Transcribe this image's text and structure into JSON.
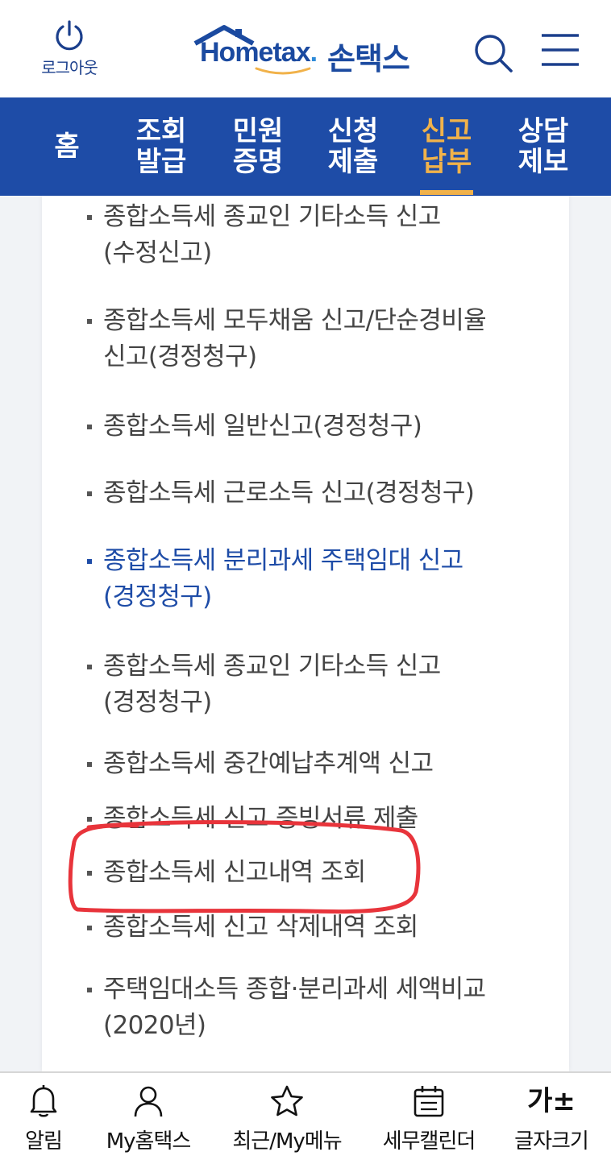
{
  "header": {
    "logout_label": "로그아웃",
    "logo_text_home": "Home",
    "logo_text_tax": "tax",
    "logo_dot": ".",
    "logo_korean": "손택스",
    "search_icon": "search-icon",
    "menu_icon": "hamburger-menu-icon",
    "brand_color": "#1e4ca7"
  },
  "gnb": {
    "items": [
      {
        "label": "홈"
      },
      {
        "label": "조회\n발급"
      },
      {
        "label": "민원\n증명"
      },
      {
        "label": "신청\n제출"
      },
      {
        "label": "신고\n납부",
        "active": true
      },
      {
        "label": "상담\n제보"
      }
    ],
    "active_color": "#f1b24a"
  },
  "menu_list": {
    "items": [
      {
        "label": "종합소득세 종교인 기타소득 신고(수정신고)"
      },
      {
        "label": "종합소득세 모두채움 신고/단순경비율 신고(경정청구)"
      },
      {
        "label": "종합소득세 일반신고(경정청구)"
      },
      {
        "label": "종합소득세 근로소득 신고(경정청구)"
      },
      {
        "label": "종합소득세 분리과세 주택임대 신고(경정청구)",
        "highlighted": true
      },
      {
        "label": "종합소득세 종교인 기타소득 신고(경정청구)"
      },
      {
        "label": "종합소득세 중간예납추계액 신고"
      },
      {
        "label": "종합소득세 신고 증빙서류 제출"
      },
      {
        "label": "종합소득세 신고내역 조회",
        "circled": true
      },
      {
        "label": "종합소득세 신고 삭제내역 조회"
      },
      {
        "label": "주택임대소득 종합·분리과세 세액비교(2020년)"
      }
    ],
    "highlight_color": "#1e4ca7",
    "annotation_color": "#e8343b"
  },
  "bottom_nav": {
    "tabs": [
      {
        "label": "알림",
        "icon": "bell-icon"
      },
      {
        "label": "My홈택스",
        "icon": "person-icon"
      },
      {
        "label": "최근/My메뉴",
        "icon": "star-icon"
      },
      {
        "label": "세무캘린더",
        "icon": "calendar-icon"
      },
      {
        "label": "글자크기",
        "icon": "font-size-icon",
        "icon_text": "가±"
      }
    ]
  }
}
